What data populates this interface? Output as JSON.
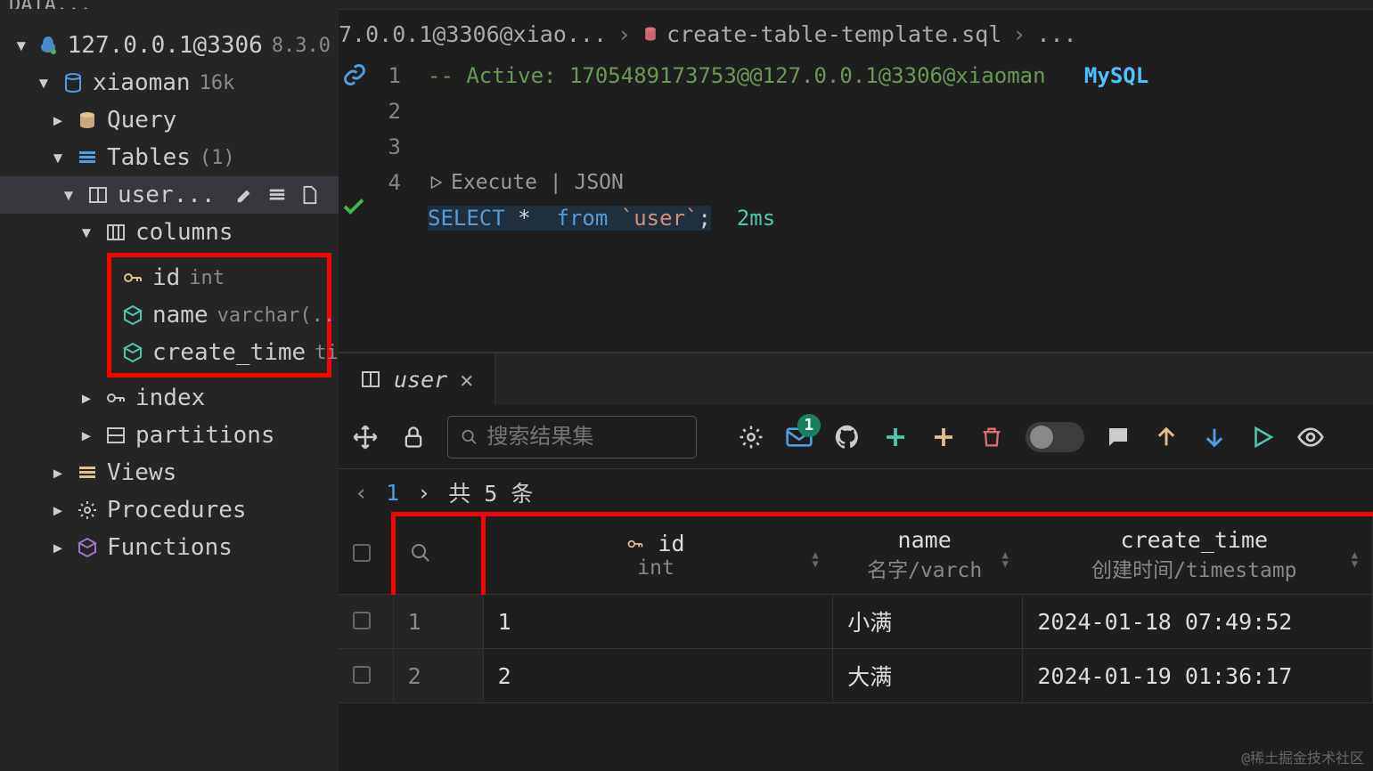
{
  "sidebar": {
    "panel_title": "DATA...",
    "connection": {
      "host": "127.0.0.1@3306",
      "version": "8.3.0"
    },
    "database": {
      "name": "xiaoman",
      "size": "16k"
    },
    "query_label": "Query",
    "tables_label": "Tables",
    "tables_count": "(1)",
    "user_label": "user...",
    "columns_label": "columns",
    "columns": [
      {
        "name": "id",
        "type": "int"
      },
      {
        "name": "name",
        "type": "varchar(..."
      },
      {
        "name": "create_time",
        "type": "ti..."
      }
    ],
    "index_label": "index",
    "partitions_label": "partitions",
    "views_label": "Views",
    "procedures_label": "Procedures",
    "functions_label": "Functions"
  },
  "breadcrumb": {
    "item1": "7.0.0.1@3306@xiao...",
    "item2": "create-table-template.sql",
    "item3": "..."
  },
  "editor": {
    "line_numbers": [
      "1",
      "2",
      "3",
      "",
      "4"
    ],
    "comment": "-- Active: 1705489173753@@127.0.0.1@3306@xiaoman",
    "mysql_tag": "MySQL",
    "codelens": "Execute | JSON",
    "sql_select": "SELECT",
    "sql_star": "*",
    "sql_from": "from",
    "sql_table": "`user`",
    "sql_semi": ";",
    "exec_time": "2ms"
  },
  "results": {
    "tab_label": "user",
    "search_placeholder": "搜索结果集",
    "mail_badge": "1",
    "page_num": "1",
    "total_text": "共 5 条",
    "headers": {
      "id": {
        "name": "id",
        "sub": "int"
      },
      "name": {
        "name": "name",
        "sub": "名字/varch"
      },
      "create_time": {
        "name": "create_time",
        "sub": "创建时间/timestamp"
      }
    },
    "rows": [
      {
        "n": "1",
        "id": "1",
        "name": "小满",
        "create_time": "2024-01-18 07:49:52"
      },
      {
        "n": "2",
        "id": "2",
        "name": "大满",
        "create_time": "2024-01-19 01:36:17"
      }
    ]
  },
  "watermark": "@稀土掘金技术社区"
}
